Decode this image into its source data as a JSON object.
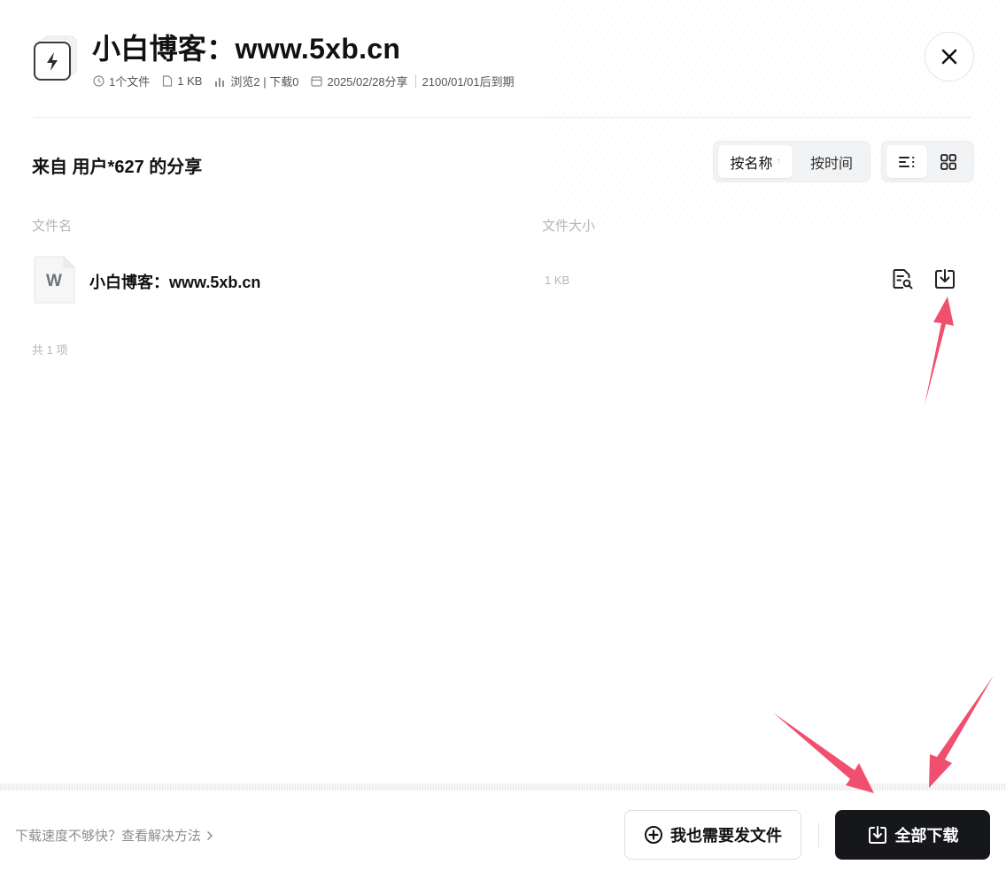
{
  "header": {
    "title": "小白博客：www.5xb.cn",
    "meta": {
      "file_count": "1个文件",
      "total_size": "1 KB",
      "stats": "浏览2 | 下载0",
      "share_date": "2025/02/28分享",
      "expiry": "2100/01/01后到期"
    }
  },
  "toolbar": {
    "from_title": "来自 用户*627 的分享",
    "sort_by_name": "按名称",
    "sort_arrow": "↑",
    "sort_by_time": "按时间"
  },
  "table": {
    "col_name": "文件名",
    "col_size": "文件大小",
    "rows": [
      {
        "icon_letter": "W",
        "name": "小白博客：www.5xb.cn",
        "size": "1 KB"
      }
    ],
    "count_text": "共 1 项"
  },
  "footer": {
    "help_text": "下载速度不够快？查看解决方法",
    "send_label": "我也需要发文件",
    "download_all_label": "全部下载"
  },
  "icons": {
    "header": "lightning-file-icon",
    "close": "close-icon",
    "list_view": "list-view-icon",
    "grid_view": "grid-view-icon",
    "file_type": "word-document-icon",
    "preview": "preview-icon",
    "download": "download-icon",
    "add": "plus-circle-icon"
  },
  "colors": {
    "primary_button": "#16171a",
    "annotation_arrow": "#f0506e",
    "muted_text": "#b4b6ba"
  }
}
